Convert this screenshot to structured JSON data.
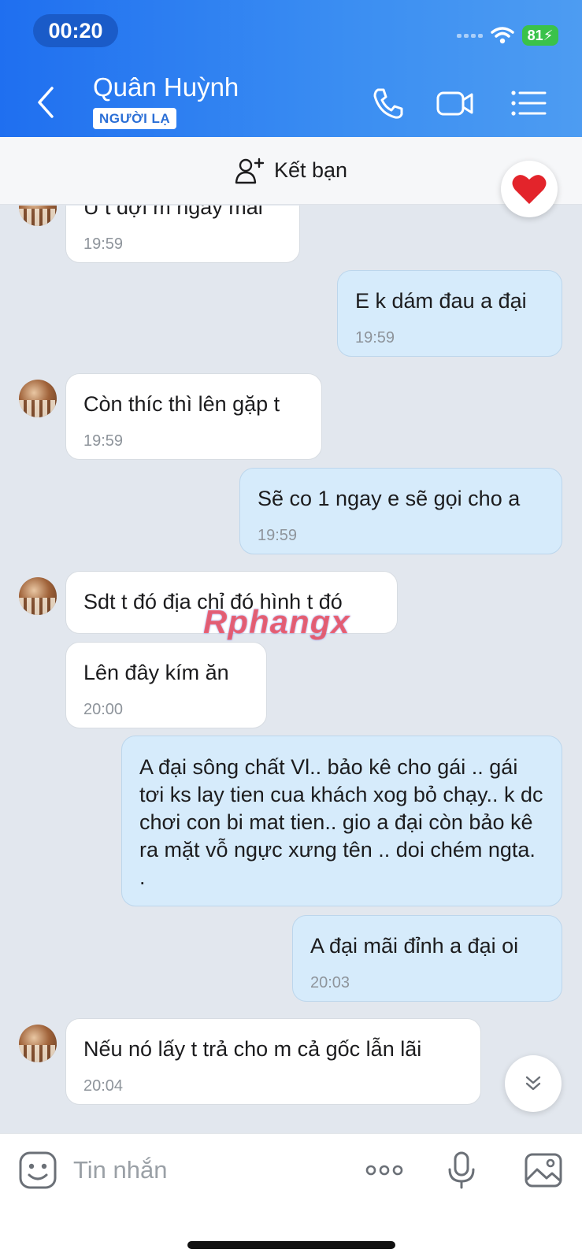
{
  "status_bar": {
    "time": "00:20",
    "battery": "81"
  },
  "header": {
    "name": "Quân Huỳnh",
    "badge": "NGƯỜI LẠ"
  },
  "add_friend": {
    "label": "Kết bạn"
  },
  "watermark": "Rphangx",
  "messages": [
    {
      "dir": "in",
      "text": "U t đợi m ngày mai",
      "time": "19:59"
    },
    {
      "dir": "out",
      "text": "E k dám đau a đại",
      "time": "19:59"
    },
    {
      "dir": "in",
      "text": "Còn thíc thì lên gặp t",
      "time": "19:59"
    },
    {
      "dir": "out",
      "text": "Sẽ co 1 ngay e sẽ gọi cho a",
      "time": "19:59"
    },
    {
      "dir": "in",
      "text": "Sdt t đó địa chỉ đó hình t đó",
      "time": ""
    },
    {
      "dir": "in",
      "text": "Lên đây kím ăn",
      "time": "20:00"
    },
    {
      "dir": "out",
      "text": "A đại sông chất Vl.. bảo kê cho gái .. gái tơi ks lay tien cua khách xog bỏ chạy.. k dc chơi con bi mat tien.. gio a đại còn bảo kê ra mặt vỗ ngực xưng tên .. doi chém ngta. .",
      "time": ""
    },
    {
      "dir": "out",
      "text": "A đại mãi đỉnh a đại oi",
      "time": "20:03"
    },
    {
      "dir": "in",
      "text": "Nếu nó lấy t trả cho m cả gốc lẫn lãi",
      "time": "20:04"
    }
  ],
  "input": {
    "placeholder": "Tin nhắn"
  }
}
